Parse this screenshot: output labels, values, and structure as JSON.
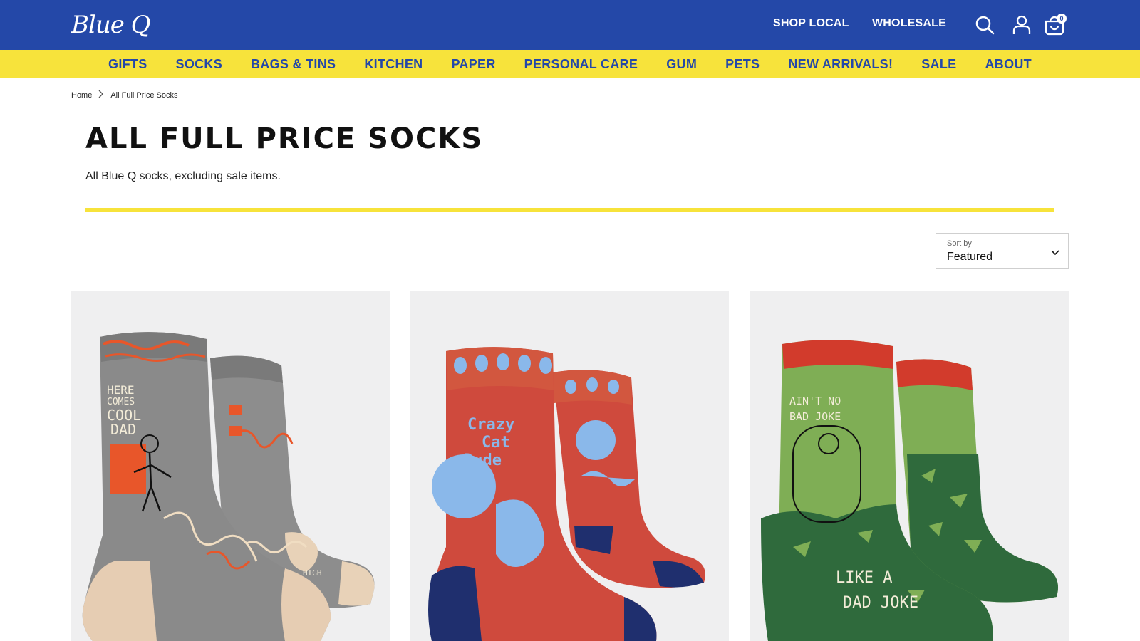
{
  "header": {
    "logo_text": "Blue Q",
    "links": [
      "SHOP LOCAL",
      "WHOLESALE"
    ],
    "icons": [
      "search-icon",
      "account-icon",
      "cart-icon"
    ],
    "cart_count": "0",
    "background": "#2448a8"
  },
  "nav": {
    "background": "#f7e33b",
    "items": [
      "GIFTS",
      "SOCKS",
      "BAGS & TINS",
      "KITCHEN",
      "PAPER",
      "PERSONAL CARE",
      "GUM",
      "PETS",
      "NEW ARRIVALS!",
      "SALE",
      "ABOUT"
    ]
  },
  "breadcrumb": [
    "Home",
    "All Full Price Socks"
  ],
  "page": {
    "title": "ALL FULL PRICE SOCKS",
    "description": "All Blue Q socks, excluding sale items."
  },
  "sort": {
    "label": "Sort by",
    "value": "Featured"
  },
  "products": [
    {
      "sock_text": [
        "HERE",
        "COMES",
        "COOL",
        "DAD"
      ],
      "ankle_text": "HIGH",
      "colors": {
        "body": "#8a8a8a",
        "accent": "#e8562a",
        "heel": "#e6cdb3"
      }
    },
    {
      "sock_text": [
        "Crazy",
        "Cat",
        "Dude"
      ],
      "colors": {
        "body": "#cf4a3d",
        "accent": "#8ab8ea",
        "heel": "#1f2f6e"
      }
    },
    {
      "sock_text": [
        "AIN'T NO",
        "BAD JOKE"
      ],
      "ankle_text": [
        "LIKE A",
        "DAD JOKE"
      ],
      "colors": {
        "body": "#7fae55",
        "accent": "#2f6a3c",
        "top": "#d23b2c"
      }
    }
  ]
}
